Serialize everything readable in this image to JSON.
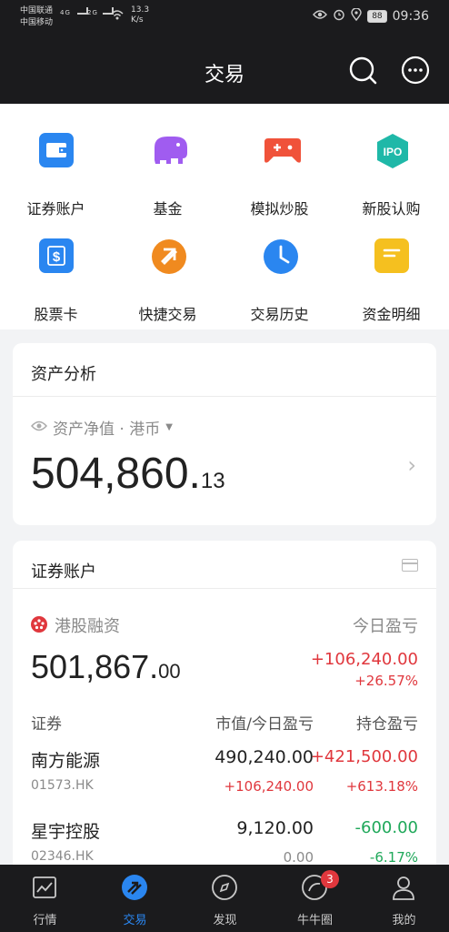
{
  "status_bar": {
    "carrier1": "中国联通",
    "carrier2": "中国移动",
    "net1": "4G",
    "net2": "2G",
    "speed": "13.3",
    "speed_unit": "K/s",
    "battery": "88",
    "time": "09:36"
  },
  "header": {
    "title": "交易"
  },
  "quick_actions": [
    {
      "label": "证券账户",
      "icon": "wallet-icon",
      "color": "#2a86f0"
    },
    {
      "label": "基金",
      "icon": "elephant-icon",
      "color": "#a05cf0"
    },
    {
      "label": "模拟炒股",
      "icon": "gamepad-icon",
      "color": "#f0523a"
    },
    {
      "label": "新股认购",
      "icon": "ipo-icon",
      "color": "#1fb8a8"
    },
    {
      "label": "股票卡",
      "icon": "dollar-card-icon",
      "color": "#2a86f0"
    },
    {
      "label": "快捷交易",
      "icon": "quick-trade-icon",
      "color": "#f08a1f"
    },
    {
      "label": "交易历史",
      "icon": "clock-icon",
      "color": "#2a86f0"
    },
    {
      "label": "资金明细",
      "icon": "ledger-icon",
      "color": "#f5c01f"
    }
  ],
  "asset_card": {
    "title": "资产分析",
    "net_label": "资产净值 · 港币",
    "value_main": "504,860.",
    "value_decimal": "13"
  },
  "account_card": {
    "title": "证券账户",
    "account_name": "港股融资",
    "today_pl_label": "今日盈亏",
    "balance_main": "501,867.",
    "balance_decimal": "00",
    "today_pl": "+106,240.00",
    "today_pl_pct": "+26.57%",
    "columns": {
      "security": "证券",
      "market_value": "市值/今日盈亏",
      "position_pl": "持仓盈亏"
    },
    "holdings": [
      {
        "name": "南方能源",
        "code": "01573.HK",
        "market_value": "490,240.00",
        "today_pl": "+106,240.00",
        "position_pl": "+421,500.00",
        "position_pl_pct": "+613.18%"
      },
      {
        "name": "星宇控股",
        "code": "02346.HK",
        "market_value": "9,120.00",
        "today_pl": "0.00",
        "position_pl": "-600.00",
        "position_pl_pct": "-6.17%"
      }
    ]
  },
  "tab_bar": {
    "items": [
      {
        "label": "行情",
        "icon": "market-chart-icon"
      },
      {
        "label": "交易",
        "icon": "trade-icon",
        "active": true
      },
      {
        "label": "发现",
        "icon": "compass-icon"
      },
      {
        "label": "牛牛圈",
        "icon": "community-icon",
        "badge": "3"
      },
      {
        "label": "我的",
        "icon": "profile-icon"
      }
    ]
  },
  "colors": {
    "accent": "#2a86f0",
    "gain": "#e0373d",
    "loss": "#1fa85a",
    "bar_bg": "#1b1b1d"
  }
}
